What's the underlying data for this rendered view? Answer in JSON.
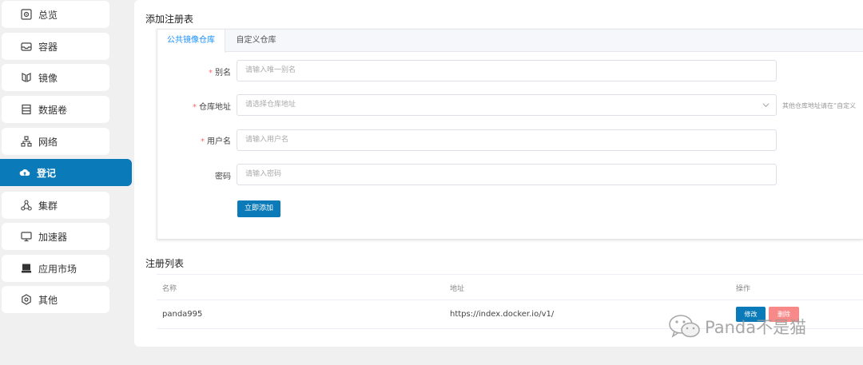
{
  "sidebar": {
    "items": [
      {
        "label": "总览",
        "icon": "overview-icon"
      },
      {
        "label": "容器",
        "icon": "container-icon"
      },
      {
        "label": "镜像",
        "icon": "image-icon"
      },
      {
        "label": "数据卷",
        "icon": "volume-icon"
      },
      {
        "label": "网络",
        "icon": "network-icon"
      },
      {
        "label": "登记",
        "icon": "cloud-upload-icon",
        "active": true
      },
      {
        "label": "集群",
        "icon": "cluster-icon"
      },
      {
        "label": "加速器",
        "icon": "monitor-icon"
      },
      {
        "label": "应用市场",
        "icon": "store-icon"
      },
      {
        "label": "其他",
        "icon": "settings-icon"
      }
    ]
  },
  "add_section": {
    "title": "添加注册表",
    "tabs": [
      {
        "label": "公共镜像仓库",
        "active": true
      },
      {
        "label": "自定义仓库",
        "active": false
      }
    ],
    "fields": {
      "alias": {
        "label": "别名",
        "required": true,
        "placeholder": "请输入唯一别名"
      },
      "repo_address": {
        "label": "仓库地址",
        "required": true,
        "placeholder": "请选择仓库地址",
        "hint": "其他仓库地址请在“自定义"
      },
      "username": {
        "label": "用户名",
        "required": true,
        "placeholder": "请输入用户名"
      },
      "password": {
        "label": "密码",
        "required": false,
        "placeholder": "请输入密码"
      }
    },
    "submit_label": "立即添加"
  },
  "list_section": {
    "title": "注册列表",
    "columns": [
      "名称",
      "地址",
      "操作"
    ],
    "rows": [
      {
        "name": "panda995",
        "address": "https://index.docker.io/v1/",
        "edit_label": "修改",
        "delete_label": "删除"
      }
    ]
  },
  "watermark": {
    "text": "Panda不是猫"
  },
  "colors": {
    "accent": "#0b7ab8",
    "danger": "#f78989",
    "required": "#f56c6c",
    "tab_active": "#1890ff"
  }
}
